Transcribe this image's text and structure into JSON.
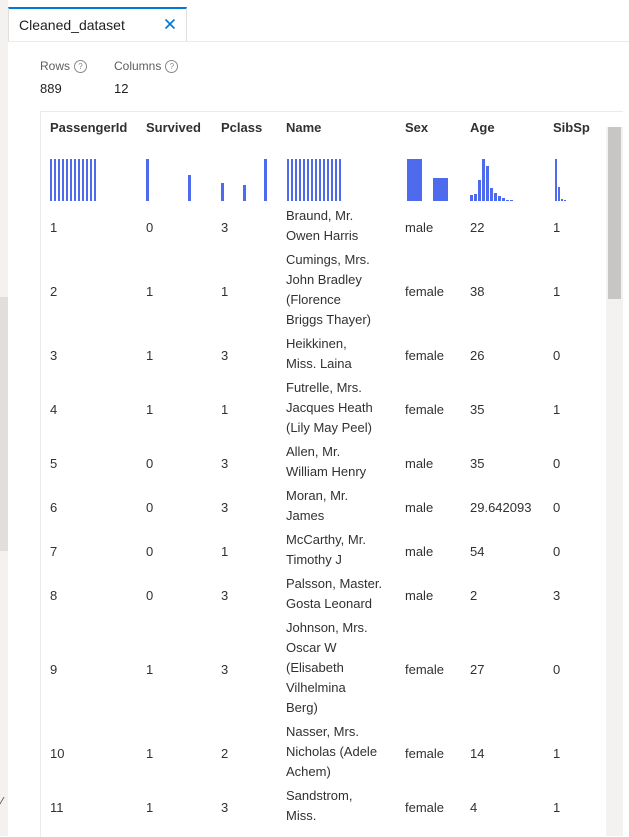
{
  "tab": {
    "title": "Cleaned_dataset",
    "close_icon": "close-icon"
  },
  "stats": {
    "rows_label": "Rows",
    "rows_value": "889",
    "columns_label": "Columns",
    "columns_value": "12",
    "info_icon": "info-icon"
  },
  "columns": [
    "PassengerId",
    "Survived",
    "Pclass",
    "Name",
    "Sex",
    "Age",
    "SibSp"
  ],
  "histograms": {
    "PassengerId": [
      1,
      1,
      1,
      1,
      1,
      1,
      1,
      1,
      1,
      1,
      1,
      1
    ],
    "Survived": [
      1.0,
      0.62
    ],
    "Pclass": [
      0.44,
      0.38,
      1.0
    ],
    "Name": [
      1,
      1,
      1,
      1,
      1,
      1,
      1,
      1,
      1,
      1,
      1,
      1,
      1,
      1
    ],
    "Sex": [
      1.0,
      0.54
    ],
    "Age": [
      0.14,
      0.16,
      0.49,
      1.0,
      0.83,
      0.32,
      0.2,
      0.11,
      0.06,
      0.03,
      0.02
    ],
    "SibSp": [
      1.0,
      0.33,
      0.05,
      0.02
    ]
  },
  "rows": [
    {
      "PassengerId": "1",
      "Survived": "0",
      "Pclass": "3",
      "Name": [
        "Braund, Mr.",
        "Owen Harris"
      ],
      "Sex": "male",
      "Age": "22",
      "SibSp": "1"
    },
    {
      "PassengerId": "2",
      "Survived": "1",
      "Pclass": "1",
      "Name": [
        "Cumings, Mrs.",
        "John Bradley",
        "(Florence",
        "Briggs Thayer)"
      ],
      "Sex": "female",
      "Age": "38",
      "SibSp": "1"
    },
    {
      "PassengerId": "3",
      "Survived": "1",
      "Pclass": "3",
      "Name": [
        "Heikkinen,",
        "Miss. Laina"
      ],
      "Sex": "female",
      "Age": "26",
      "SibSp": "0"
    },
    {
      "PassengerId": "4",
      "Survived": "1",
      "Pclass": "1",
      "Name": [
        "Futrelle, Mrs.",
        "Jacques Heath",
        "(Lily May Peel)"
      ],
      "Sex": "female",
      "Age": "35",
      "SibSp": "1"
    },
    {
      "PassengerId": "5",
      "Survived": "0",
      "Pclass": "3",
      "Name": [
        "Allen, Mr.",
        "William Henry"
      ],
      "Sex": "male",
      "Age": "35",
      "SibSp": "0"
    },
    {
      "PassengerId": "6",
      "Survived": "0",
      "Pclass": "3",
      "Name": [
        "Moran, Mr.",
        "James"
      ],
      "Sex": "male",
      "Age": "29.642093",
      "SibSp": "0"
    },
    {
      "PassengerId": "7",
      "Survived": "0",
      "Pclass": "1",
      "Name": [
        "McCarthy, Mr.",
        "Timothy J"
      ],
      "Sex": "male",
      "Age": "54",
      "SibSp": "0"
    },
    {
      "PassengerId": "8",
      "Survived": "0",
      "Pclass": "3",
      "Name": [
        "Palsson, Master.",
        "Gosta Leonard"
      ],
      "Sex": "male",
      "Age": "2",
      "SibSp": "3"
    },
    {
      "PassengerId": "9",
      "Survived": "1",
      "Pclass": "3",
      "Name": [
        "Johnson, Mrs.",
        "Oscar W",
        "(Elisabeth",
        "Vilhelmina",
        "Berg)"
      ],
      "Sex": "female",
      "Age": "27",
      "SibSp": "0"
    },
    {
      "PassengerId": "10",
      "Survived": "1",
      "Pclass": "2",
      "Name": [
        "Nasser, Mrs.",
        "Nicholas (Adele",
        "Achem)"
      ],
      "Sex": "female",
      "Age": "14",
      "SibSp": "1"
    },
    {
      "PassengerId": "11",
      "Survived": "1",
      "Pclass": "3",
      "Name": [
        "Sandstrom,",
        "Miss."
      ],
      "Sex": "female",
      "Age": "4",
      "SibSp": "1"
    }
  ],
  "colors": {
    "accent": "#0078d4",
    "histogram": "#4f6bed"
  }
}
